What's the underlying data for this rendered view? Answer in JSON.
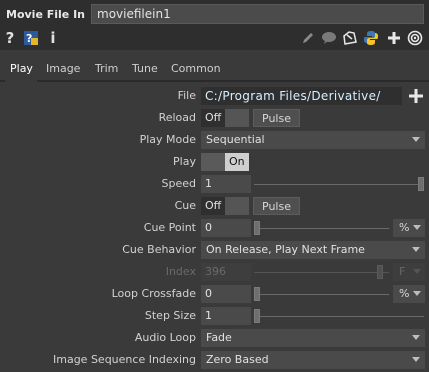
{
  "header": {
    "op_type": "Movie File In",
    "op_name": "moviefilein1"
  },
  "iconbar": {
    "left_icons": [
      "help-icon",
      "python-help-icon",
      "info-icon"
    ],
    "right_icons": [
      "pencil-icon",
      "comment-icon",
      "clone-icon",
      "python-icon",
      "add-icon",
      "target-icon"
    ],
    "help_glyph": "?",
    "info_glyph": "i"
  },
  "tabs": [
    {
      "label": "Play",
      "active": true
    },
    {
      "label": "Image",
      "active": false
    },
    {
      "label": "Trim",
      "active": false
    },
    {
      "label": "Tune",
      "active": false
    },
    {
      "label": "Common",
      "active": false
    }
  ],
  "params": {
    "file": {
      "label": "File",
      "value": "C:/Program Files/Derivative/"
    },
    "reload": {
      "label": "Reload",
      "toggle": "Off",
      "button": "Pulse"
    },
    "play_mode": {
      "label": "Play Mode",
      "value": "Sequential"
    },
    "play": {
      "label": "Play",
      "value": "On"
    },
    "speed": {
      "label": "Speed",
      "value": "1",
      "slider_level": 1.0
    },
    "cue": {
      "label": "Cue",
      "toggle": "Off",
      "button": "Pulse"
    },
    "cue_point": {
      "label": "Cue Point",
      "value": "0",
      "unit": "%",
      "slider_level": 0.0
    },
    "cue_behavior": {
      "label": "Cue Behavior",
      "value": "On Release, Play Next Frame"
    },
    "index": {
      "label": "Index",
      "value": "396",
      "unit": "F",
      "slider_level": 0.95,
      "disabled": true
    },
    "loop_crossfade": {
      "label": "Loop Crossfade",
      "value": "0",
      "unit": "%",
      "slider_level": 0.0
    },
    "step_size": {
      "label": "Step Size",
      "value": "1",
      "slider_level": 0.0
    },
    "audio_loop": {
      "label": "Audio Loop",
      "value": "Fade"
    },
    "image_seq": {
      "label": "Image Sequence Indexing",
      "value": "Zero Based"
    }
  },
  "colors": {
    "panel_bg": "#3a3a3a",
    "bar_bg": "#2e2e2e",
    "field_bg": "#4a4a4a",
    "file_text": "#d6f0ff"
  }
}
